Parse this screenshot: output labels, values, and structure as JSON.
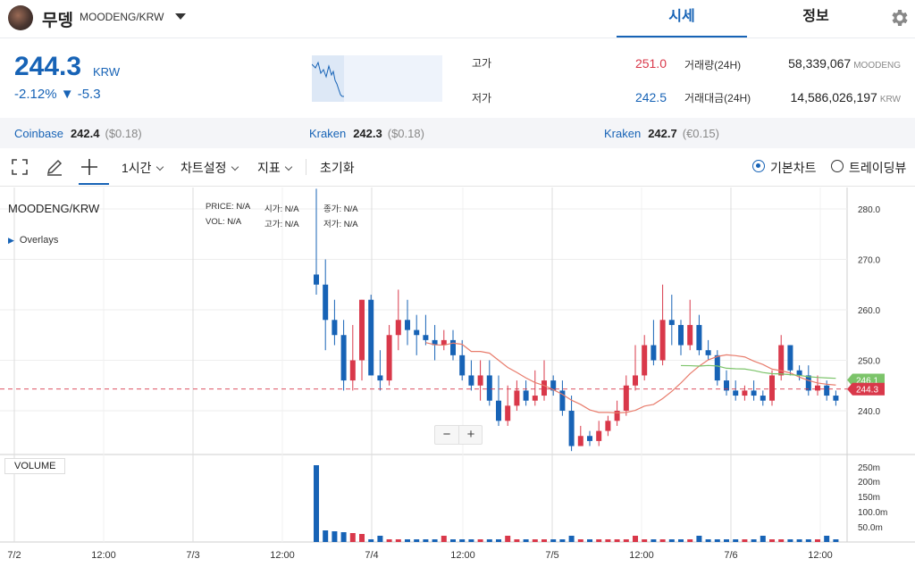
{
  "header": {
    "coin_name": "무뎅",
    "pair": "MOODENG/KRW",
    "tabs": [
      {
        "label": "시세"
      },
      {
        "label": "정보"
      }
    ]
  },
  "summary": {
    "price": "244.3",
    "unit": "KRW",
    "change": "-2.12% ▼ -5.3",
    "high_label": "고가",
    "high_value": "251.0",
    "low_label": "저가",
    "low_value": "242.5",
    "vol_label": "거래량(24H)",
    "vol_value": "58,339,067",
    "vol_unit": "MOODENG",
    "amt_label": "거래대금(24H)",
    "amt_value": "14,586,026,197",
    "amt_unit": "KRW"
  },
  "exchanges": [
    {
      "name": "Coinbase",
      "price": "242.4",
      "diff": "($0.18)"
    },
    {
      "name": "Kraken",
      "price": "242.3",
      "diff": "($0.18)"
    },
    {
      "name": "Kraken",
      "price": "242.7",
      "diff": "(€0.15)"
    }
  ],
  "toolbar": {
    "interval": "1시간",
    "chart_settings": "차트설정",
    "indicators": "지표",
    "reset": "초기화",
    "basic_chart": "기본차트",
    "trading_view": "트레이딩뷰"
  },
  "chart": {
    "title": "MOODENG/KRW",
    "overlays": "Overlays",
    "legend": {
      "price_label": "PRICE:",
      "price_value": "N/A",
      "open_label": "시가:",
      "open_value": "N/A",
      "close_label": "종가:",
      "close_value": "N/A",
      "vol_label": "VOL:",
      "vol_value": "N/A",
      "high_label": "고가:",
      "high_value": "N/A",
      "low_label": "저가:",
      "low_value": "N/A"
    },
    "volume_label": "VOLUME",
    "zoom_out": "−",
    "zoom_in": "+",
    "current_price_tag": "244.3",
    "ma_tag": "246.1",
    "y_ticks": [
      "280.0",
      "270.0",
      "260.0",
      "250.0",
      "240.0"
    ],
    "y_tick_values": [
      280,
      270,
      260,
      250,
      240
    ],
    "vol_ticks": [
      "250m",
      "200m",
      "150m",
      "100.0m",
      "50.0m"
    ],
    "x_ticks": [
      "7/2",
      "12:00",
      "7/3",
      "12:00",
      "7/4",
      "12:00",
      "7/5",
      "12:00",
      "7/6",
      "12:00"
    ],
    "colors": {
      "up": "#d9384a",
      "down": "#1763b6",
      "ma_short": "#e87c6c",
      "ma_long": "#7cc46a"
    }
  },
  "chart_data": {
    "type": "candlestick",
    "ylim": [
      233,
      284
    ],
    "candles": [
      [
        267,
        265,
        284,
        263
      ],
      [
        265,
        258,
        270,
        252
      ],
      [
        258,
        255,
        262,
        253
      ],
      [
        255,
        246,
        258,
        244
      ],
      [
        246,
        250,
        257,
        244
      ],
      [
        250,
        262,
        262,
        246
      ],
      [
        262,
        247,
        263,
        247
      ],
      [
        247,
        246,
        252,
        244
      ],
      [
        246,
        255,
        257,
        245
      ],
      [
        255,
        258,
        264,
        252
      ],
      [
        258,
        256,
        262,
        253
      ],
      [
        256,
        255,
        259,
        251
      ],
      [
        255,
        254,
        259,
        253
      ],
      [
        254,
        253,
        257,
        250
      ],
      [
        253,
        254,
        256,
        252
      ],
      [
        254,
        251,
        256,
        250
      ],
      [
        251,
        247,
        254,
        246
      ],
      [
        247,
        245,
        250,
        244
      ],
      [
        245,
        247,
        250,
        242
      ],
      [
        247,
        242,
        250,
        241
      ],
      [
        242,
        238,
        247,
        237
      ],
      [
        238,
        241,
        245,
        237
      ],
      [
        241,
        244,
        246,
        240
      ],
      [
        244,
        242,
        246,
        241
      ],
      [
        242,
        243,
        248,
        241
      ],
      [
        243,
        246,
        250,
        242
      ],
      [
        246,
        244,
        247,
        243
      ],
      [
        244,
        240,
        246,
        239
      ],
      [
        240,
        233,
        243,
        232
      ],
      [
        233,
        235,
        237,
        233
      ],
      [
        235,
        234,
        236,
        233
      ],
      [
        234,
        236,
        238,
        233
      ],
      [
        236,
        238,
        239,
        235
      ],
      [
        238,
        240,
        242,
        237
      ],
      [
        240,
        245,
        247,
        239
      ],
      [
        245,
        247,
        253,
        244
      ],
      [
        247,
        253,
        255,
        246
      ],
      [
        253,
        250,
        258,
        249
      ],
      [
        250,
        258,
        265,
        249
      ],
      [
        258,
        257,
        263,
        253
      ],
      [
        257,
        253,
        258,
        251
      ],
      [
        253,
        257,
        262,
        252
      ],
      [
        257,
        252,
        259,
        251
      ],
      [
        252,
        251,
        254,
        250
      ],
      [
        251,
        246,
        252,
        245
      ],
      [
        246,
        244,
        248,
        243
      ],
      [
        244,
        243,
        246,
        242
      ],
      [
        243,
        244,
        245,
        242
      ],
      [
        244,
        243,
        246,
        242
      ],
      [
        243,
        242,
        244,
        241
      ],
      [
        242,
        247,
        248,
        241
      ],
      [
        247,
        253,
        255,
        246
      ],
      [
        253,
        248,
        253,
        247
      ],
      [
        248,
        247,
        249,
        246
      ],
      [
        247,
        244,
        249,
        243
      ],
      [
        244,
        245,
        247,
        243
      ],
      [
        245,
        243,
        246,
        242
      ],
      [
        243,
        242,
        244,
        241
      ]
    ]
  }
}
